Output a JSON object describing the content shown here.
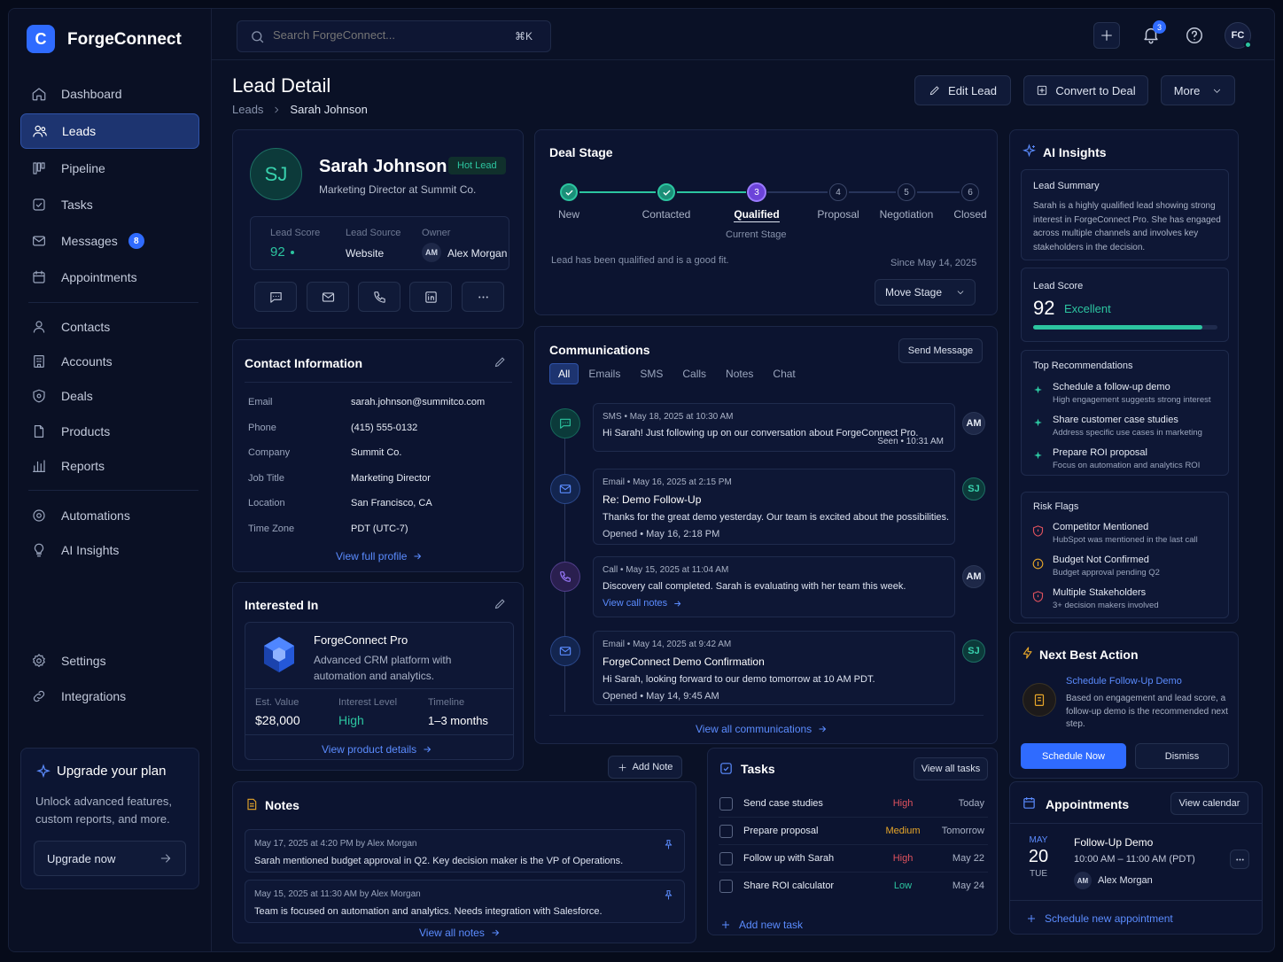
{
  "colors": {
    "accent": "#3b7bff",
    "success": "#2cc5a0",
    "danger": "#e0525e",
    "warning": "#e7a629"
  },
  "brand": {
    "logo_letter": "C",
    "name": "ForgeConnect"
  },
  "search": {
    "placeholder": "Search ForgeConnect...",
    "shortcut": "⌘K"
  },
  "header": {
    "notification_count": "3",
    "user_initials": "FC"
  },
  "nav": {
    "main": [
      {
        "label": "Dashboard",
        "icon": "home-icon"
      },
      {
        "label": "Leads",
        "icon": "users-icon"
      },
      {
        "label": "Pipeline",
        "icon": "pipeline-icon"
      },
      {
        "label": "Tasks",
        "icon": "check-square-icon"
      },
      {
        "label": "Messages",
        "icon": "mail-icon",
        "badge": "8"
      },
      {
        "label": "Appointments",
        "icon": "calendar-icon"
      }
    ],
    "records": [
      {
        "label": "Contacts",
        "icon": "user-icon"
      },
      {
        "label": "Accounts",
        "icon": "building-icon"
      },
      {
        "label": "Deals",
        "icon": "dollar-icon"
      },
      {
        "label": "Products",
        "icon": "box-icon"
      },
      {
        "label": "Reports",
        "icon": "bar-chart-icon"
      }
    ],
    "tools": [
      {
        "label": "Automations",
        "icon": "automation-icon"
      },
      {
        "label": "AI Insights",
        "icon": "bulb-icon"
      }
    ],
    "bottom": [
      {
        "label": "Settings",
        "icon": "gear-icon"
      },
      {
        "label": "Integrations",
        "icon": "link-icon"
      }
    ]
  },
  "upgrade": {
    "title": "Upgrade your plan",
    "text": "Unlock advanced features, custom reports, and more.",
    "button": "Upgrade now"
  },
  "page": {
    "title": "Lead Detail",
    "breadcrumb_parent": "Leads",
    "breadcrumb_current": "Sarah Johnson",
    "edit_button": "Edit Lead",
    "convert_button": "Convert to Deal",
    "more_button": "More"
  },
  "lead": {
    "initials": "SJ",
    "name": "Sarah Johnson",
    "tag": "Hot Lead",
    "title": "Marketing Director at Summit Co.",
    "score_label": "Lead Score",
    "score": "92",
    "source_label": "Lead Source",
    "source": "Website",
    "owner_label": "Owner",
    "owner_initials": "AM",
    "owner": "Alex Morgan"
  },
  "contact": {
    "title": "Contact Information",
    "fields": [
      {
        "label": "Email",
        "value": "sarah.johnson@summitco.com"
      },
      {
        "label": "Phone",
        "value": "(415) 555-0132"
      },
      {
        "label": "Company",
        "value": "Summit Co."
      },
      {
        "label": "Job Title",
        "value": "Marketing Director"
      },
      {
        "label": "Location",
        "value": "San Francisco, CA"
      },
      {
        "label": "Time Zone",
        "value": "PDT (UTC-7)"
      }
    ],
    "link": "View full profile"
  },
  "interest": {
    "title": "Interested In",
    "product": "ForgeConnect Pro",
    "description": "Advanced CRM platform with automation and analytics.",
    "value_label": "Est. Value",
    "value": "$28,000",
    "level_label": "Interest Level",
    "level": "High",
    "timeline_label": "Timeline",
    "timeline": "1–3 months",
    "link": "View product details"
  },
  "notes": {
    "title": "Notes",
    "add_button": "Add Note",
    "items": [
      {
        "meta": "May 17, 2025 at 4:20 PM by Alex Morgan",
        "text": "Sarah mentioned budget approval in Q2. Key decision maker is the VP of Operations."
      },
      {
        "meta": "May 15, 2025 at 11:30 AM by Alex Morgan",
        "text": "Team is focused on automation and analytics. Needs integration with Salesforce."
      }
    ],
    "link": "View all notes"
  },
  "deal": {
    "title": "Deal Stage",
    "stages": [
      {
        "num": "",
        "label": "New",
        "state": "done"
      },
      {
        "num": "",
        "label": "Contacted",
        "state": "done"
      },
      {
        "num": "3",
        "label": "Qualified",
        "state": "current"
      },
      {
        "num": "4",
        "label": "Proposal",
        "state": "todo"
      },
      {
        "num": "5",
        "label": "Negotiation",
        "state": "todo"
      },
      {
        "num": "6",
        "label": "Closed",
        "state": "todo"
      }
    ],
    "current_caption": "Current Stage",
    "note": "Lead has been qualified and is a good fit.",
    "since": "Since May 14, 2025",
    "move_button": "Move Stage"
  },
  "comms": {
    "title": "Communications",
    "send_button": "Send Message",
    "tabs": [
      "All",
      "Emails",
      "SMS",
      "Calls",
      "Notes",
      "Chat"
    ],
    "items": [
      {
        "type": "sms",
        "meta": "SMS  •  May 18, 2025 at 10:30 AM",
        "subject": "",
        "body": "Hi Sarah! Just following up on our conversation about ForgeConnect Pro.",
        "footer": "Seen  •  10:31 AM",
        "avatar": "AM"
      },
      {
        "type": "email",
        "meta": "Email  •  May 16, 2025 at 2:15 PM",
        "subject": "Re: Demo Follow-Up",
        "body": "Thanks for the great demo yesterday. Our team is excited about the possibilities.",
        "footer": "Opened  •  May 16, 2:18 PM",
        "avatar": "SJ"
      },
      {
        "type": "call",
        "meta": "Call  •  May 15, 2025 at 11:04 AM",
        "subject": "",
        "body": "Discovery call completed. Sarah is evaluating with her team this week.",
        "footer": "View call notes",
        "avatar": "AM"
      },
      {
        "type": "email",
        "meta": "Email  •  May 14, 2025 at 9:42 AM",
        "subject": "ForgeConnect Demo Confirmation",
        "body": "Hi Sarah, looking forward to our demo tomorrow at 10 AM PDT.",
        "footer": "Opened  •  May 14, 9:45 AM",
        "avatar": "SJ"
      }
    ],
    "link": "View all communications"
  },
  "tasks": {
    "title": "Tasks",
    "view_button": "View all tasks",
    "items": [
      {
        "name": "Send case studies",
        "priority": "High",
        "due": "Today"
      },
      {
        "name": "Prepare proposal",
        "priority": "Medium",
        "due": "Tomorrow"
      },
      {
        "name": "Follow up with Sarah",
        "priority": "High",
        "due": "May 22"
      },
      {
        "name": "Share ROI calculator",
        "priority": "Low",
        "due": "May 24"
      }
    ],
    "add": "Add new task"
  },
  "insights": {
    "title": "AI Insights",
    "summary_title": "Lead Summary",
    "summary": "Sarah is a highly qualified lead showing strong interest in ForgeConnect Pro. She has engaged across multiple channels and involves key stakeholders in the decision.",
    "score_title": "Lead Score",
    "score": "92",
    "score_label": "Excellent",
    "score_fraction": 0.92,
    "rec_title": "Top Recommendations",
    "recs": [
      {
        "title": "Schedule a follow-up demo",
        "sub": "High engagement suggests strong interest"
      },
      {
        "title": "Share customer case studies",
        "sub": "Address specific use cases in marketing"
      },
      {
        "title": "Prepare ROI proposal",
        "sub": "Focus on automation and analytics ROI"
      }
    ],
    "risk_title": "Risk Flags",
    "risks": [
      {
        "title": "Competitor Mentioned",
        "sub": "HubSpot was mentioned in the last call"
      },
      {
        "title": "Budget Not Confirmed",
        "sub": "Budget approval pending Q2"
      },
      {
        "title": "Multiple Stakeholders",
        "sub": "3+ decision makers involved"
      }
    ]
  },
  "nba": {
    "title": "Next Best Action",
    "action": "Schedule Follow-Up Demo",
    "text": "Based on engagement and lead score, a follow-up demo is the recommended next step.",
    "primary": "Schedule Now",
    "secondary": "Dismiss"
  },
  "appointments": {
    "title": "Appointments",
    "view_button": "View calendar",
    "month": "MAY",
    "day": "20",
    "weekday": "TUE",
    "event": "Follow-Up Demo",
    "time": "10:00 AM – 11:00 AM (PDT)",
    "attendee_initials": "AM",
    "attendee": "Alex Morgan",
    "add": "Schedule new appointment"
  }
}
